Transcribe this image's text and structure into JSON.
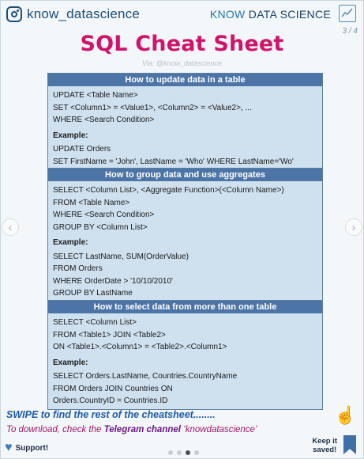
{
  "header": {
    "handle": "know_datascience",
    "brand_know": "KNOW",
    "brand_ds": "DATA SCIENCE",
    "page_indicator": "3 / 4",
    "title": "SQL Cheat Sheet",
    "via": "Via: @know_datascience"
  },
  "sections": [
    {
      "title": "How to update data in a table",
      "syntax": [
        "UPDATE <Table Name>",
        "SET <Column1> = <Value1>, <Column2> = <Value2>, ...",
        "WHERE <Search Condition>"
      ],
      "example_label": "Example:",
      "example": [
        "UPDATE Orders",
        "SET FirstName = 'John', LastName = 'Who' WHERE LastName='Wo'"
      ]
    },
    {
      "title": "How to group data and use aggregates",
      "syntax": [
        "SELECT <Column List>, <Aggregate Function>(<Column Name>)",
        "FROM <Table Name>",
        "WHERE <Search Condition>",
        "GROUP BY <Column List>"
      ],
      "example_label": "Example:",
      "example": [
        "SELECT LastName, SUM(OrderValue)",
        "FROM Orders",
        "WHERE OrderDate > '10/10/2010'",
        "GROUP BY LastName"
      ]
    },
    {
      "title": "How to select data from more than one table",
      "syntax": [
        "SELECT <Column List>",
        "FROM <Table1> JOIN <Table2>",
        "ON <Table1>.<Column1> = <Table2>.<Column1>"
      ],
      "example_label": "Example:",
      "example": [
        "SELECT Orders.LastName, Countries.CountryName",
        "FROM Orders JOIN Countries ON",
        "Orders.CountryID = Countries.ID"
      ]
    }
  ],
  "footer": {
    "swipe": "SWIPE to find the rest of the cheatsheet........",
    "download_prefix": "To download, check the ",
    "download_channel": "Telegram channel",
    "download_suffix": " ‘knowdatascience’",
    "support": "Support!",
    "keep_line1": "Keep it",
    "keep_line2": "saved!"
  },
  "icons": {
    "instagram": "instagram-icon",
    "chart": "line-chart-icon",
    "hand": "swipe-hand-icon",
    "heart": "heart-icon",
    "bookmark": "bookmark-icon"
  },
  "colors": {
    "title": "#d0136b",
    "section_header": "#4c74a6",
    "section_body": "#cfe0ee",
    "swipe": "#1a5aa6",
    "download": "#a3146a"
  },
  "carousel": {
    "total": 4,
    "active": 3
  }
}
